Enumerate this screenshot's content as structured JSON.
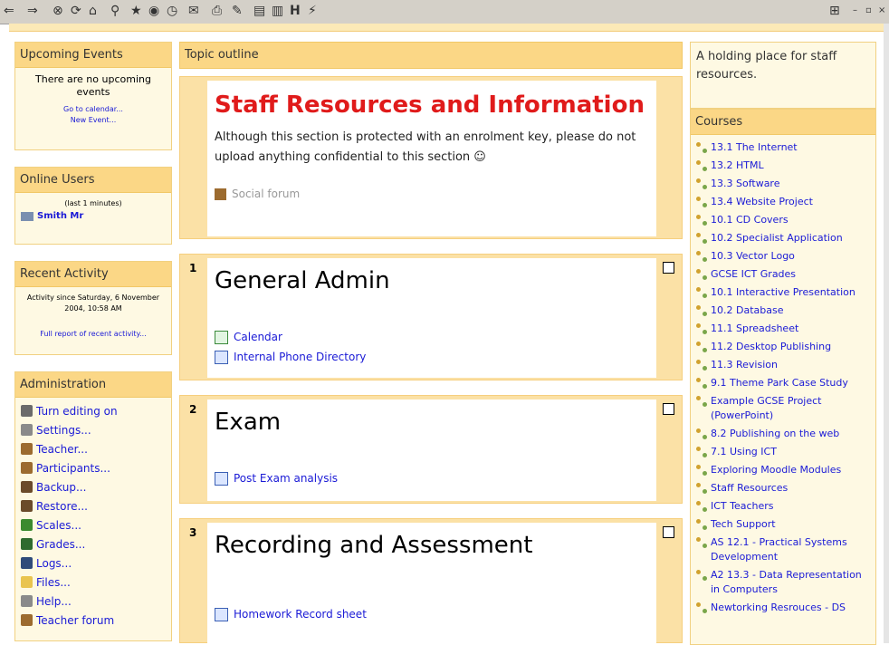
{
  "toolbar": {
    "tool_icons": [
      "back-icon",
      "forward-icon",
      "stop-icon",
      "refresh-icon",
      "home-icon",
      "search-icon",
      "favorites-icon",
      "media-icon",
      "history-icon",
      "mail-icon",
      "print-icon",
      "edit-icon",
      "discuss-icon",
      "messenger-icon",
      "research-icon",
      "h-icon",
      "tools-icon"
    ],
    "window_buttons": [
      "minimize",
      "restore",
      "close"
    ]
  },
  "left": {
    "upcoming": {
      "title": "Upcoming Events",
      "none_text": "There are no upcoming events",
      "go_calendar": "Go to calendar...",
      "new_event": "New Event..."
    },
    "online": {
      "title": "Online Users",
      "period": "(last 1 minutes)",
      "user": "Smith Mr"
    },
    "recent": {
      "title": "Recent Activity",
      "since": "Activity since Saturday, 6 November 2004, 10:58 AM",
      "full_report": "Full report of recent activity..."
    },
    "admin": {
      "title": "Administration",
      "items": [
        {
          "label": "Turn editing on",
          "icon": "pencil-icon",
          "color": "#6b6b6b"
        },
        {
          "label": "Settings...",
          "icon": "settings-icon",
          "color": "#8a8a8a"
        },
        {
          "label": "Teacher...",
          "icon": "teacher-icon",
          "color": "#9c6b2f"
        },
        {
          "label": "Participants...",
          "icon": "participants-icon",
          "color": "#9c6b2f"
        },
        {
          "label": "Backup...",
          "icon": "backup-icon",
          "color": "#6b4b2a"
        },
        {
          "label": "Restore...",
          "icon": "restore-icon",
          "color": "#6b4b2a"
        },
        {
          "label": "Scales...",
          "icon": "scales-icon",
          "color": "#3b8a2f"
        },
        {
          "label": "Grades...",
          "icon": "grades-icon",
          "color": "#2f6b2f"
        },
        {
          "label": "Logs...",
          "icon": "logs-icon",
          "color": "#2f4b7a"
        },
        {
          "label": "Files...",
          "icon": "folder-icon",
          "color": "#e9c44f"
        },
        {
          "label": "Help...",
          "icon": "help-icon",
          "color": "#8a8a8a"
        },
        {
          "label": "Teacher forum",
          "icon": "forum-icon",
          "color": "#9c6b2f"
        }
      ]
    }
  },
  "center": {
    "header": "Topic outline",
    "sections": [
      {
        "number": "",
        "title": "Staff Resources and Information",
        "summary": "Although this section is protected with an enrolment key, please do not upload anything confidential to this section ☺",
        "items": [
          {
            "label": "Social forum",
            "icon": "forum-icon"
          }
        ]
      },
      {
        "number": "1",
        "title": "General Admin",
        "items": [
          {
            "label": "Calendar",
            "icon": "calendar-icon"
          },
          {
            "label": "Internal Phone Directory",
            "icon": "doc-icon"
          }
        ]
      },
      {
        "number": "2",
        "title": "Exam",
        "items": [
          {
            "label": "Post Exam analysis",
            "icon": "doc-icon"
          }
        ]
      },
      {
        "number": "3",
        "title": "Recording and Assessment",
        "items": [
          {
            "label": "Homework Record sheet",
            "icon": "doc-icon"
          }
        ]
      }
    ]
  },
  "right": {
    "description": "A holding place for staff resources.",
    "courses_title": "Courses",
    "courses": [
      "13.1 The Internet",
      "13.2 HTML",
      "13.3 Software",
      "13.4 Website Project",
      "10.1 CD Covers",
      "10.2 Specialist Application",
      "10.3 Vector Logo",
      "GCSE ICT Grades",
      "10.1 Interactive Presentation",
      "10.2 Database",
      "11.1 Spreadsheet",
      "11.2 Desktop Publishing",
      "11.3 Revision",
      "9.1 Theme Park Case Study",
      "Example GCSE Project (PowerPoint)",
      "8.2 Publishing on the web",
      "7.1 Using ICT",
      "Exploring Moodle Modules",
      "Staff Resources",
      "ICT Teachers",
      "Tech Support",
      "AS 12.1 - Practical Systems Development",
      "A2 13.3 - Data Representation in Computers",
      "Newtorking Resrouces - DS"
    ]
  }
}
